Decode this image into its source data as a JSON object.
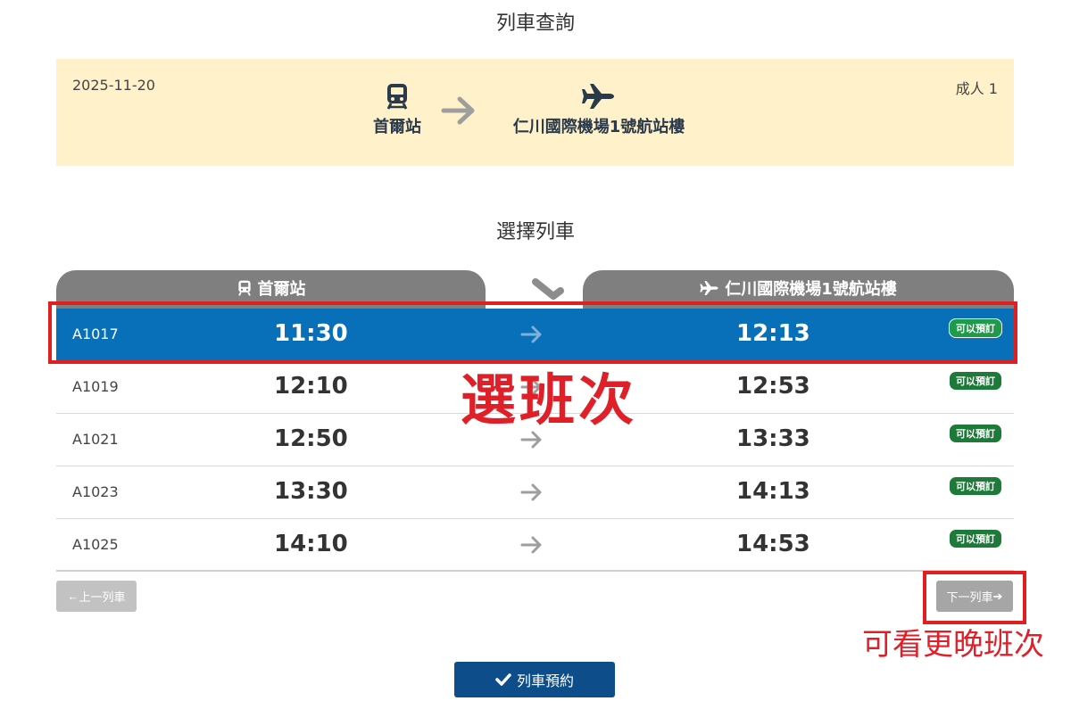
{
  "page": {
    "title": "列車查詢",
    "section_title": "選擇列車"
  },
  "summary": {
    "date": "2025-11-20",
    "passengers": "成人 1",
    "from_station": "首爾站",
    "to_station": "仁川國際機場1號航站樓",
    "from_icon": "train-icon",
    "to_icon": "airplane-icon"
  },
  "table_header": {
    "from_label": "首爾站",
    "to_label": "仁川國際機場1號航站樓"
  },
  "trains": [
    {
      "train_no": "A1017",
      "depart": "11:30",
      "arrive": "12:13",
      "status": "可以預訂",
      "selected": true
    },
    {
      "train_no": "A1019",
      "depart": "12:10",
      "arrive": "12:53",
      "status": "可以預訂",
      "selected": false
    },
    {
      "train_no": "A1021",
      "depart": "12:50",
      "arrive": "13:33",
      "status": "可以預訂",
      "selected": false
    },
    {
      "train_no": "A1023",
      "depart": "13:30",
      "arrive": "14:13",
      "status": "可以預訂",
      "selected": false
    },
    {
      "train_no": "A1025",
      "depart": "14:10",
      "arrive": "14:53",
      "status": "可以預訂",
      "selected": false
    }
  ],
  "buttons": {
    "prev_train": "上一列車",
    "next_train": "下一列車",
    "reserve": "列車預約"
  },
  "annotations": {
    "select_train": "選班次",
    "see_later": "可看更晚班次"
  },
  "colors": {
    "summary_bg": "#fff1c9",
    "selected_row": "#0870b8",
    "header_tab": "#7f7f7f",
    "badge_green": "#1e7a38",
    "reserve_button": "#0d4e8a",
    "annotation_red": "#e02020"
  }
}
